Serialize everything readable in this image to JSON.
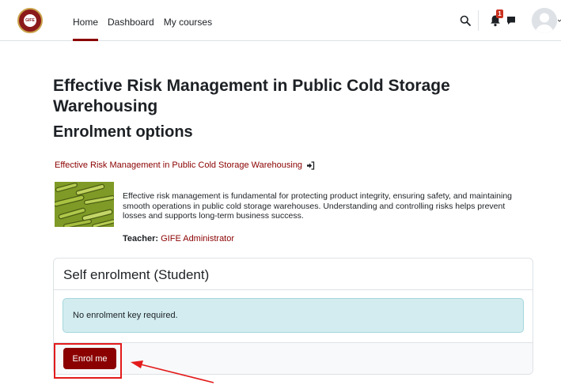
{
  "nav": {
    "logo_text": "GIFE",
    "links": [
      {
        "label": "Home",
        "active": true
      },
      {
        "label": "Dashboard",
        "active": false
      },
      {
        "label": "My courses",
        "active": false
      }
    ],
    "notification_count": "1"
  },
  "page": {
    "title": "Effective Risk Management in Public Cold Storage Warehousing",
    "subtitle": "Enrolment options",
    "course_link": "Effective Risk Management in Public Cold Storage Warehousing",
    "summary": "Effective risk management is fundamental for protecting product integrity, ensuring safety, and maintaining smooth operations in public cold storage warehouses. Understanding and controlling risks helps prevent losses and supports long-term business success.",
    "teacher_label": "Teacher:",
    "teacher_name": "GIFE Administrator"
  },
  "enrolment": {
    "header": "Self enrolment (Student)",
    "alert": "No enrolment key required.",
    "button": "Enrol me"
  },
  "colors": {
    "brand": "#8b0000",
    "highlight": "#e31b1b",
    "alert_bg": "#d2ecef"
  }
}
